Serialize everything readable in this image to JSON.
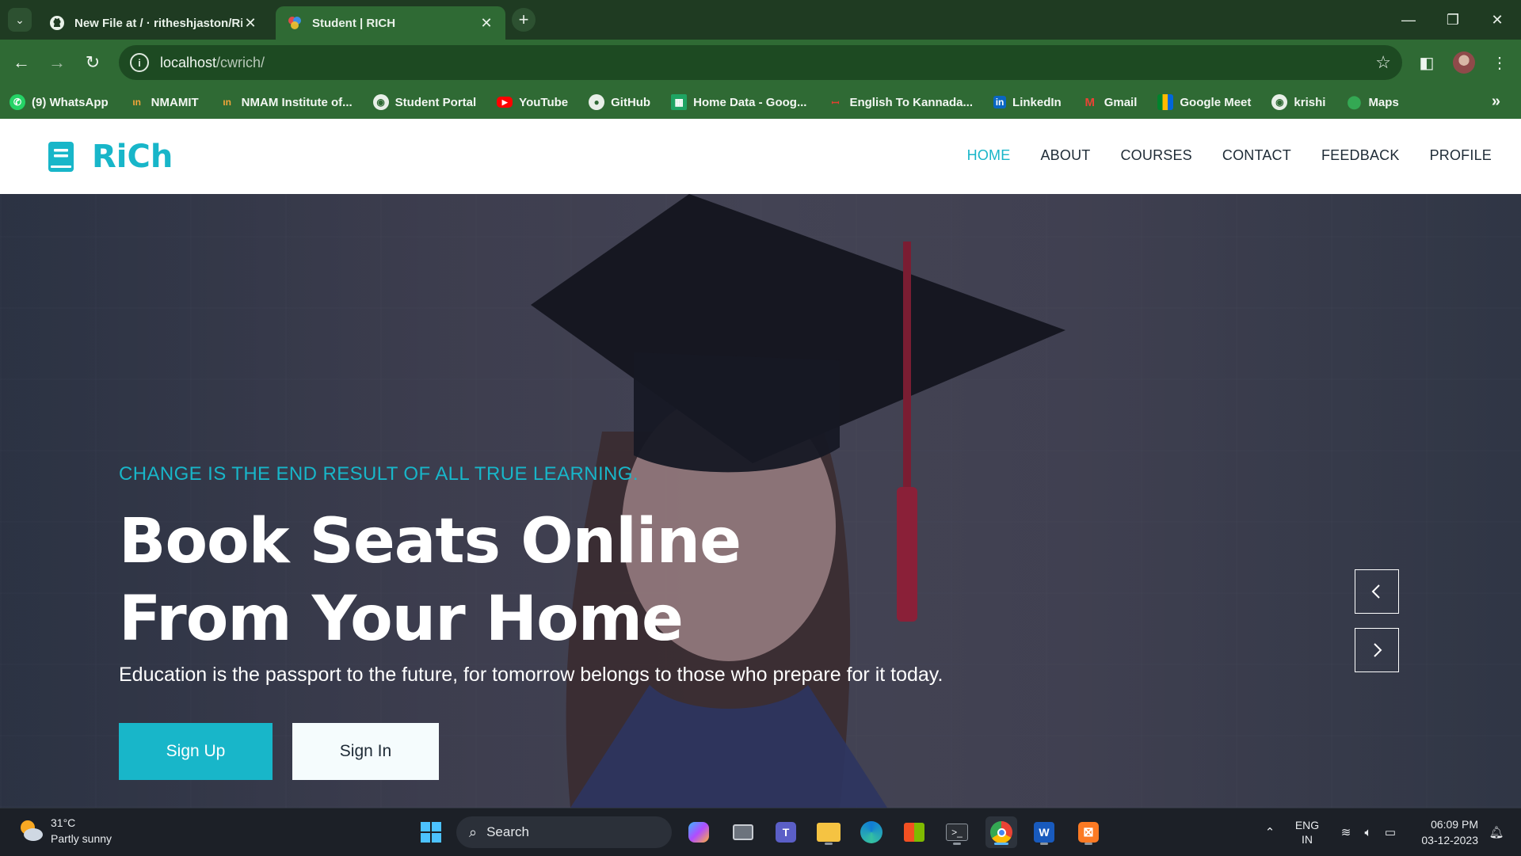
{
  "browser": {
    "tabs": [
      {
        "title": "New File at / · ritheshjaston/Ri",
        "favicon": "github-icon",
        "active": false
      },
      {
        "title": "Student | RICH",
        "favicon": "site-favicon",
        "active": true
      }
    ],
    "url_host": "localhost",
    "url_path": "/cwrich/",
    "bookmarks": [
      {
        "label": "(9) WhatsApp",
        "icon": "whatsapp-icon"
      },
      {
        "label": "NMAMIT",
        "icon": "nmamit-icon"
      },
      {
        "label": "NMAM Institute of...",
        "icon": "nmamit-icon"
      },
      {
        "label": "Student Portal",
        "icon": "globe-icon"
      },
      {
        "label": "YouTube",
        "icon": "youtube-icon"
      },
      {
        "label": "GitHub",
        "icon": "github-icon"
      },
      {
        "label": "Home Data - Goog...",
        "icon": "sheets-icon"
      },
      {
        "label": "English To Kannada...",
        "icon": "translate-icon"
      },
      {
        "label": "LinkedIn",
        "icon": "linkedin-icon"
      },
      {
        "label": "Gmail",
        "icon": "gmail-icon"
      },
      {
        "label": "Google Meet",
        "icon": "meet-icon"
      },
      {
        "label": "krishi",
        "icon": "globe-icon"
      },
      {
        "label": "Maps",
        "icon": "maps-icon"
      }
    ]
  },
  "site": {
    "brand": "RiCh",
    "menu": [
      "HOME",
      "ABOUT",
      "COURSES",
      "CONTACT",
      "FEEDBACK",
      "PROFILE"
    ],
    "active_menu": "HOME",
    "hero": {
      "tagline": "CHANGE IS THE END RESULT OF ALL TRUE LEARNING.",
      "title": "Book Seats Online From Your Home",
      "subtitle": "Education is the passport to the future, for tomorrow belongs to those who prepare for it today.",
      "primary_button": "Sign Up",
      "secondary_button": "Sign In"
    },
    "colors": {
      "accent": "#18b6c9",
      "text_dark": "#1e2b36",
      "white": "#ffffff"
    }
  },
  "taskbar": {
    "weather_temp": "31°C",
    "weather_desc": "Partly sunny",
    "search_label": "Search",
    "lang_top": "ENG",
    "lang_bottom": "IN",
    "time": "06:09 PM",
    "date": "03-12-2023"
  }
}
